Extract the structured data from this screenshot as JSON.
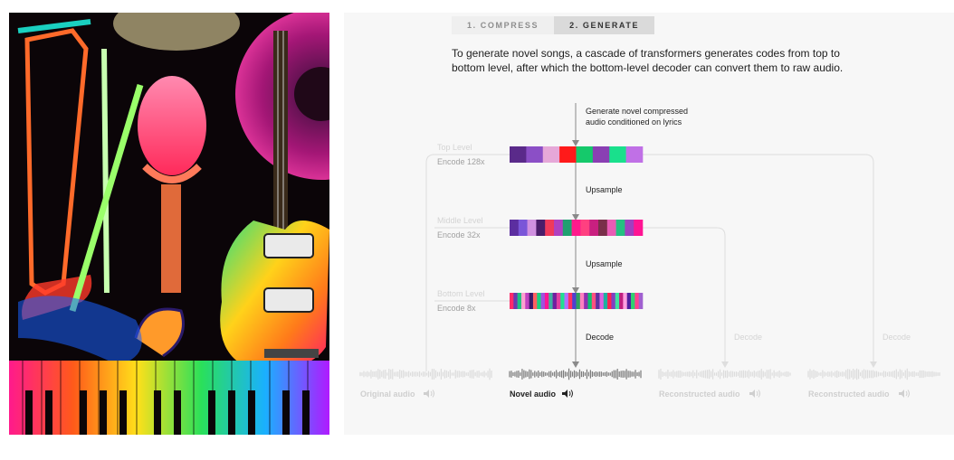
{
  "tabs": [
    {
      "label": "1. COMPRESS",
      "active": false
    },
    {
      "label": "2. GENERATE",
      "active": true
    }
  ],
  "description": "To generate novel songs, a cascade of transformers generates codes from top to bottom level, after which the bottom-level decoder can convert them to raw audio.",
  "diagram": {
    "generate_note": [
      "Generate novel compressed",
      "audio conditioned on lyrics"
    ],
    "levels": [
      {
        "name": "Top Level",
        "encode": "Encode 128x"
      },
      {
        "name": "Middle Level",
        "encode": "Encode 32x"
      },
      {
        "name": "Bottom Level",
        "encode": "Encode 8x"
      }
    ],
    "upsample_1": "Upsample",
    "upsample_2": "Upsample",
    "decode_main": "Decode",
    "decode_right_1": "Decode",
    "decode_right_2": "Decode",
    "audio": [
      {
        "label": "Original audio",
        "icon": "speaker-icon"
      },
      {
        "label": "Novel audio",
        "icon": "speaker-icon"
      },
      {
        "label": "Reconstructed audio",
        "icon": "speaker-icon"
      },
      {
        "label": "Reconstructed audio",
        "icon": "speaker-icon"
      }
    ],
    "colors": {
      "top_codes": [
        "#5a2a8a",
        "#8b4fc6",
        "#e6a8d8",
        "#ff1a1a",
        "#15c96b",
        "#8a3fb3",
        "#19e08c",
        "#c070e6"
      ],
      "middle_codes": [
        "#5c2ea0",
        "#7a56d8",
        "#d090e0",
        "#4a1d6a",
        "#f03a5a",
        "#b040c0",
        "#20a070",
        "#ff1a8c",
        "#ff4080",
        "#c92080",
        "#7a2f4a",
        "#e95cb5",
        "#24c080",
        "#a040c0",
        "#ff1493"
      ],
      "bottom_codes": [
        "#ff2a6a",
        "#6a3ab0",
        "#20c080",
        "#ffa0d0",
        "#c040c0",
        "#3a1a6a",
        "#ff6060",
        "#1ad080",
        "#a050e0",
        "#ff1493",
        "#40b0a0",
        "#7020a0",
        "#e040a0",
        "#20e090",
        "#b070ff",
        "#ff3060",
        "#5040d0",
        "#30a060",
        "#ff80c0",
        "#9030b0",
        "#10c070",
        "#ff5080",
        "#6030a0",
        "#e060e0",
        "#20b0a0",
        "#ff2050",
        "#8040c0",
        "#40e0a0",
        "#c02080",
        "#ffa0e0",
        "#5020a0",
        "#30d070",
        "#ff4090",
        "#a060d0"
      ],
      "faded": "#dcdcdc",
      "dark": "#222222",
      "accent_line": "#8a8a8a"
    }
  }
}
